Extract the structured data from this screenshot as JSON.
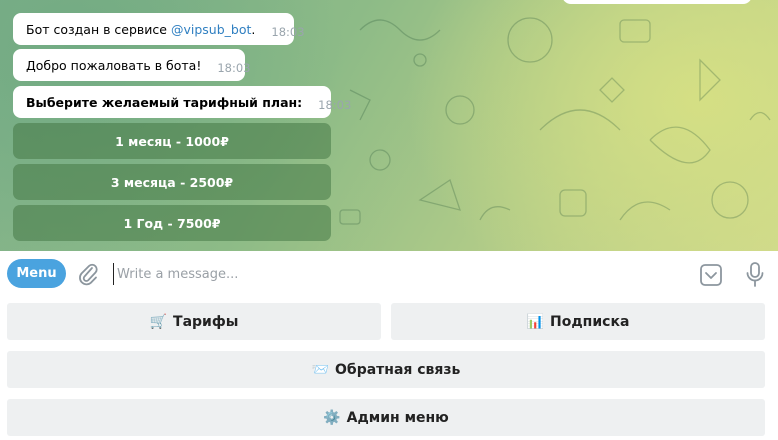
{
  "messages": [
    {
      "text": "Бот создан в сервисе ",
      "mention": "@vipsub_bot",
      "suffix": ".",
      "time": "18:03"
    },
    {
      "text": "Добро пожаловать в бота!",
      "time": "18:03"
    },
    {
      "text": "Выберите желаемый тарифный план:",
      "time": "18:03"
    }
  ],
  "inline_buttons": [
    {
      "label": "1 месяц - 1000₽"
    },
    {
      "label": "3 месяца - 2500₽"
    },
    {
      "label": "1 Год - 7500₽"
    }
  ],
  "composer": {
    "menu_label": "Menu",
    "placeholder": "Write a message...",
    "value": ""
  },
  "reply_keyboard": [
    {
      "emoji": "🛒",
      "label": "Тарифы"
    },
    {
      "emoji": "📊",
      "label": "Подписка"
    },
    {
      "emoji": "📨",
      "label": "Обратная связь"
    },
    {
      "emoji": "⚙️",
      "label": "Админ меню"
    }
  ],
  "colors": {
    "accent": "#4aa3df",
    "mention": "#2f7fc1",
    "inline_button_bg": "rgba(70,120,70,0.55)",
    "reply_button_bg": "#eef0f1"
  }
}
